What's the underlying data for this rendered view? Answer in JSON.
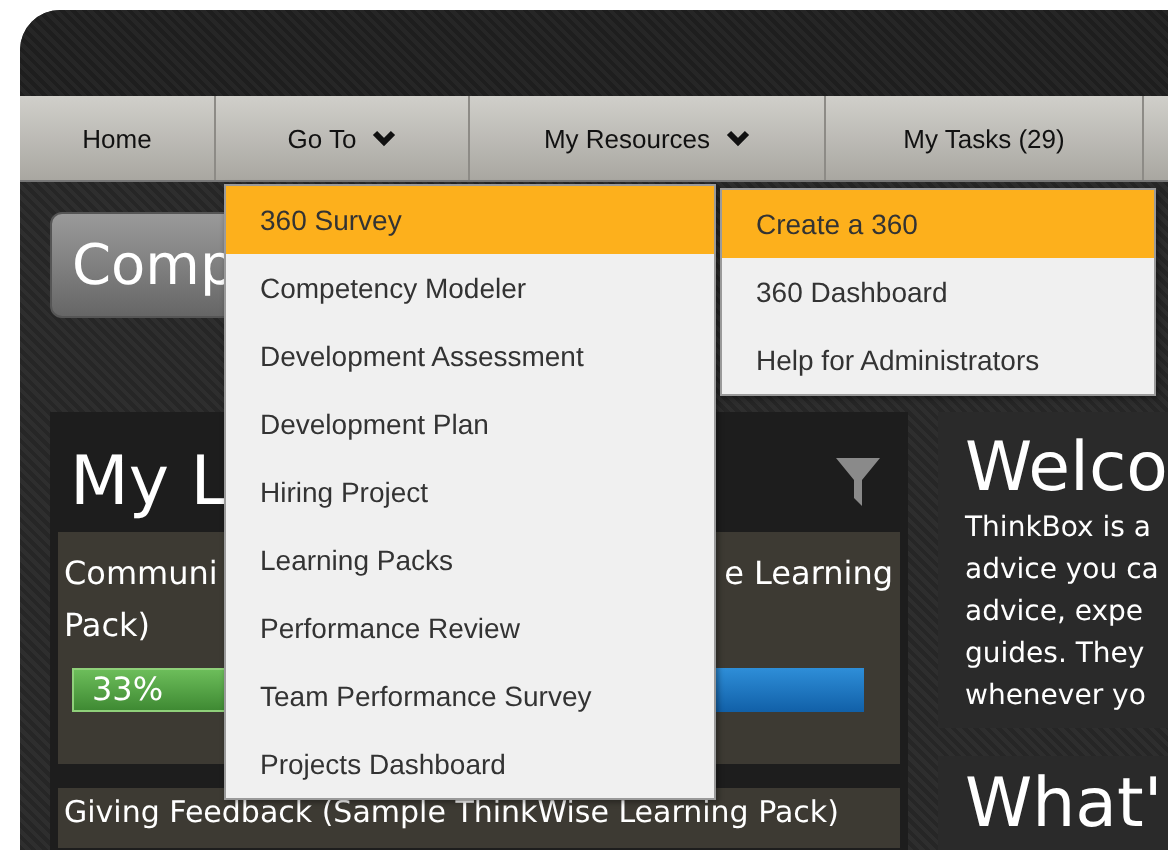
{
  "nav": [
    {
      "label": "Home",
      "kind": "link"
    },
    {
      "label": "Go To",
      "kind": "menu"
    },
    {
      "label": "My Resources",
      "kind": "menu"
    },
    {
      "label": "My Tasks (29)",
      "kind": "link"
    }
  ],
  "page_button": {
    "label": "Comp"
  },
  "learning_panel": {
    "title": "My L",
    "cards": [
      {
        "title_left": "Communi",
        "title_right": "e Learning",
        "title_line2": "Pack)",
        "progress": {
          "label": "33%",
          "level": 0.33
        }
      },
      {
        "title_left": "Giving Feedback (Sample ThinkWise Learning Pack)"
      }
    ]
  },
  "welcome_panel": {
    "title": "Welco",
    "lines": [
      "ThinkBox is a",
      "advice you ca",
      "advice, expe",
      "guides. They",
      "whenever yo"
    ]
  },
  "next_panel": {
    "title": "What'"
  },
  "goto_menu": [
    {
      "label": "360 Survey",
      "selected": true
    },
    {
      "label": "Competency Modeler",
      "selected": false
    },
    {
      "label": "Development Assessment",
      "selected": false
    },
    {
      "label": "Development Plan",
      "selected": false
    },
    {
      "label": "Hiring Project",
      "selected": false
    },
    {
      "label": "Learning Packs",
      "selected": false
    },
    {
      "label": "Performance Review",
      "selected": false
    },
    {
      "label": "Team Performance Survey",
      "selected": false
    },
    {
      "label": "Projects Dashboard",
      "selected": false
    }
  ],
  "submenu": [
    {
      "label": "Create a 360",
      "selected": true
    },
    {
      "label": "360 Dashboard",
      "selected": false
    },
    {
      "label": "Help for Administrators",
      "selected": false
    }
  ]
}
